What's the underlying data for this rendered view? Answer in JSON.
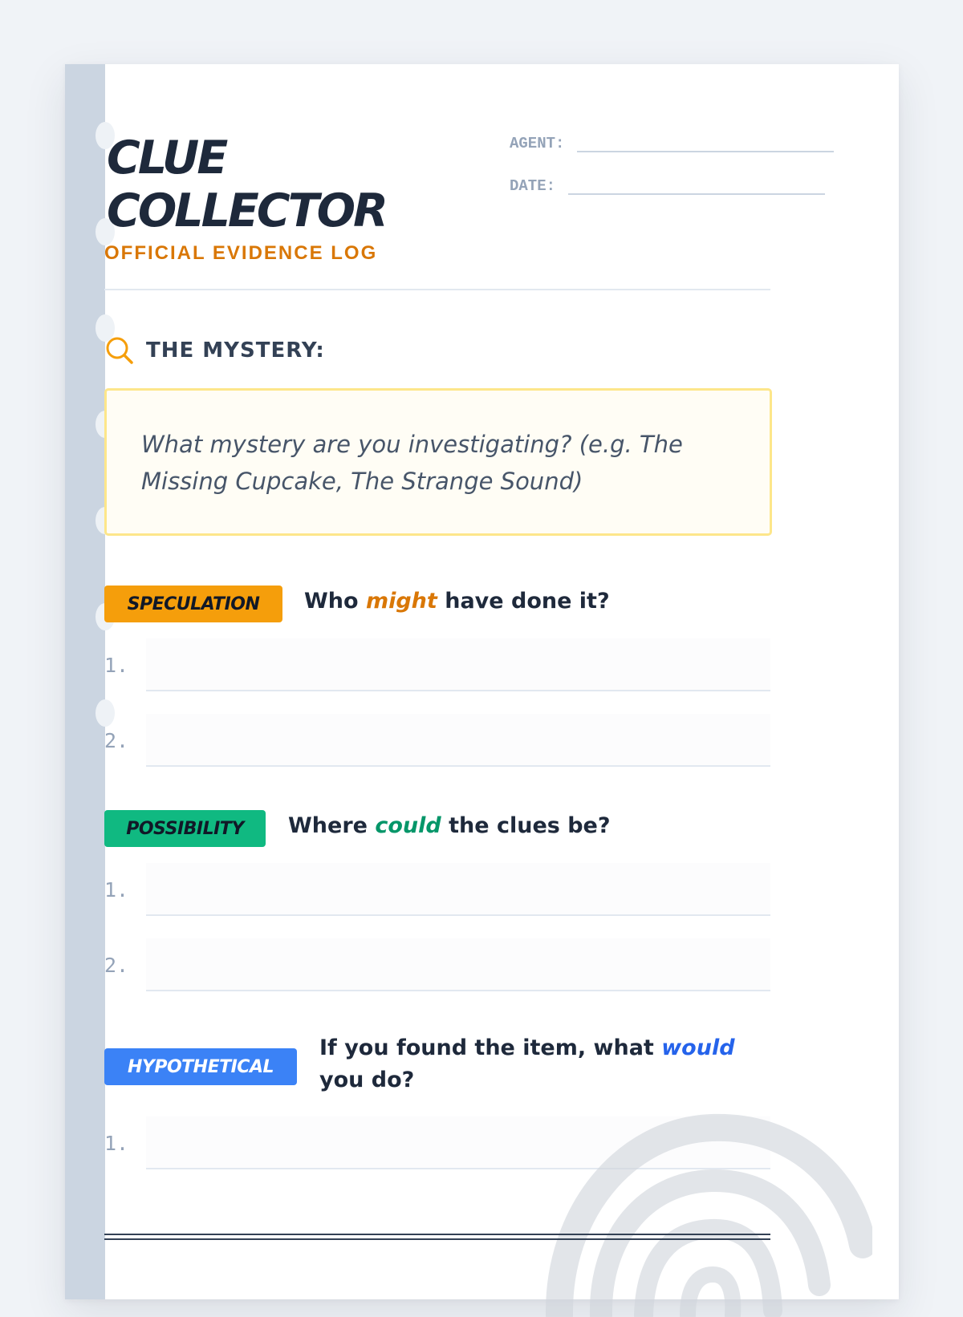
{
  "title": {
    "line1": "CLUE",
    "line2": "COLLECTOR"
  },
  "subtitle": "OFFICIAL EVIDENCE LOG",
  "meta": {
    "agent_label": "AGENT:",
    "date_label": "DATE:"
  },
  "mystery": {
    "heading": "THE MYSTERY:",
    "prompt": "What mystery are you investigating? (e.g. The Missing Cupcake, The Strange Sound)"
  },
  "sections": [
    {
      "badge": "SPECULATION",
      "question_before": "Who",
      "question_emphasis": "might",
      "question_after": "have done it?",
      "color": "#f59e0b",
      "emphasis_color": "#d97706",
      "answers": [
        "1.",
        "2."
      ]
    },
    {
      "badge": "POSSIBILITY",
      "question_before": "Where",
      "question_emphasis": "could",
      "question_after": "the clues be?",
      "color": "#10b981",
      "emphasis_color": "#059669",
      "answers": [
        "1.",
        "2."
      ]
    },
    {
      "badge": "HYPOTHETICAL",
      "question_before": "If you found the item, what",
      "question_emphasis": "would",
      "question_after": "you do?",
      "color": "#3b82f6",
      "emphasis_color": "#2563eb",
      "answers": [
        "1."
      ]
    }
  ],
  "icons": {
    "mystery": "magnifying-glass-icon",
    "watermark": "fingerprint-icon"
  }
}
